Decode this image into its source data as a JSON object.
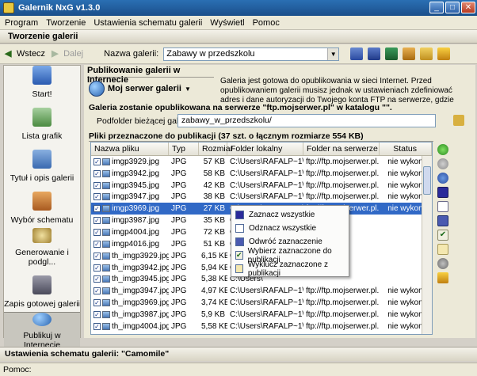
{
  "window": {
    "title": "Galernik NxG v1.3.0"
  },
  "menu": [
    "Program",
    "Tworzenie",
    "Ustawienia schematu galerii",
    "Wyświetl",
    "Pomoc"
  ],
  "section_title": "Tworzenie galerii",
  "toolbar": {
    "back_label": "Wstecz",
    "next_label": "Dalej",
    "gallery_label": "Nazwa galerii:",
    "gallery_value": "Zabawy w przedszkolu"
  },
  "sidebar": [
    {
      "label": "Start!"
    },
    {
      "label": "Lista grafik"
    },
    {
      "label": "Tytuł i opis galerii"
    },
    {
      "label": "Wybór schematu"
    },
    {
      "label": "Generowanie i podgl..."
    },
    {
      "label": "Zapis gotowej galerii"
    },
    {
      "label": "Publikuj w Internecie"
    }
  ],
  "publish": {
    "header": "Publikowanie galerii w Internecie",
    "server_button": "Moj serwer galerii",
    "info": "Galeria jest gotowa do opublikowania w sieci Internet. Przed opublikowaniem galerii musisz jednak w ustawieniach zdefiniować adres i dane autoryzacji do Twojego konta FTP na serwerze, gdzie znajdować się będzie galeria.",
    "target_line": "Galeria zostanie opublikowana na serwerze \"ftp.mojserwer.pl\" w katalogu \"\".",
    "subfolder_label": "Podfolder bieżącej galerii:",
    "subfolder_value": "zabawy_w_przedszkolu/"
  },
  "files": {
    "title": "Pliki przeznaczone do publikacji (37 szt. o łącznym rozmiarze 554 KB)",
    "columns": [
      "Nazwa pliku",
      "Typ",
      "Rozmiar",
      "Folder lokalny",
      "Folder na serwerze",
      "Status"
    ],
    "rows": [
      {
        "name": "imgp3929.jpg",
        "type": "JPG",
        "size": "57 KB",
        "local": "C:\\Users\\RAFALP~1\\...",
        "server": "ftp://ftp.mojserwer.pl...",
        "status": "nie wykon..."
      },
      {
        "name": "imgp3942.jpg",
        "type": "JPG",
        "size": "58 KB",
        "local": "C:\\Users\\RAFALP~1\\...",
        "server": "ftp://ftp.mojserwer.pl...",
        "status": "nie wykon..."
      },
      {
        "name": "imgp3945.jpg",
        "type": "JPG",
        "size": "42 KB",
        "local": "C:\\Users\\RAFALP~1\\...",
        "server": "ftp://ftp.mojserwer.pl...",
        "status": "nie wykon..."
      },
      {
        "name": "imgp3947.jpg",
        "type": "JPG",
        "size": "38 KB",
        "local": "C:\\Users\\RAFALP~1\\...",
        "server": "ftp://ftp.mojserwer.pl...",
        "status": "nie wykon..."
      },
      {
        "name": "imgp3969.jpg",
        "type": "JPG",
        "size": "27 KB",
        "local": "C:\\Users\\RAFALP~1\\...",
        "server": "ftp://ftp.mojserwer.pl...",
        "status": "nie wykon..."
      },
      {
        "name": "imgp3987.jpg",
        "type": "JPG",
        "size": "35 KB",
        "local": "C:\\Users\\",
        "server": "",
        "status": ""
      },
      {
        "name": "imgp4004.jpg",
        "type": "JPG",
        "size": "72 KB",
        "local": "C:\\Users\\",
        "server": "",
        "status": ""
      },
      {
        "name": "imgp4016.jpg",
        "type": "JPG",
        "size": "51 KB",
        "local": "C:\\Users\\",
        "server": "",
        "status": ""
      },
      {
        "name": "th_imgp3929.jpg",
        "type": "JPG",
        "size": "6,15 KB",
        "local": "C:\\Users\\",
        "server": "",
        "status": ""
      },
      {
        "name": "th_imgp3942.jpg",
        "type": "JPG",
        "size": "5,94 KB",
        "local": "C:\\Users\\",
        "server": "",
        "status": ""
      },
      {
        "name": "th_imgp3945.jpg",
        "type": "JPG",
        "size": "5,38 KB",
        "local": "C:\\Users\\",
        "server": "",
        "status": ""
      },
      {
        "name": "th_imgp3947.jpg",
        "type": "JPG",
        "size": "4,97 KB",
        "local": "C:\\Users\\RAFALP~1\\...",
        "server": "ftp://ftp.mojserwer.pl...",
        "status": "nie wykon..."
      },
      {
        "name": "th_imgp3969.jpg",
        "type": "JPG",
        "size": "3,74 KB",
        "local": "C:\\Users\\RAFALP~1\\...",
        "server": "ftp://ftp.mojserwer.pl...",
        "status": "nie wykon..."
      },
      {
        "name": "th_imgp3987.jpg",
        "type": "JPG",
        "size": "5,9 KB",
        "local": "C:\\Users\\RAFALP~1\\...",
        "server": "ftp://ftp.mojserwer.pl...",
        "status": "nie wykon..."
      },
      {
        "name": "th_imgp4004.jpg",
        "type": "JPG",
        "size": "5,58 KB",
        "local": "C:\\Users\\RAFALP~1\\...",
        "server": "ftp://ftp.mojserwer.pl...",
        "status": "nie wykon..."
      },
      {
        "name": "th_imgp4016.jpg",
        "type": "JPG",
        "size": "5,56 KB",
        "local": "C:\\Users\\RAFALP~1\\...",
        "server": "ftp://ftp.mojserwer.pl...",
        "status": "nie wykon..."
      }
    ],
    "selected_row_name": "imgp3969.jpg"
  },
  "context_menu": [
    "Zaznacz wszystkie",
    "Odznacz wszystkie",
    "Odwróć zaznaczenie",
    "Wybierz zaznaczone do publikacji",
    "Wyklucz zaznaczone z publikacji"
  ],
  "footer_title": "Ustawienia schematu galerii: \"Camomile\"",
  "status_text": "Pomoc:",
  "colors": {
    "titlebar": "#1b4f8a",
    "selection": "#3169c6"
  }
}
